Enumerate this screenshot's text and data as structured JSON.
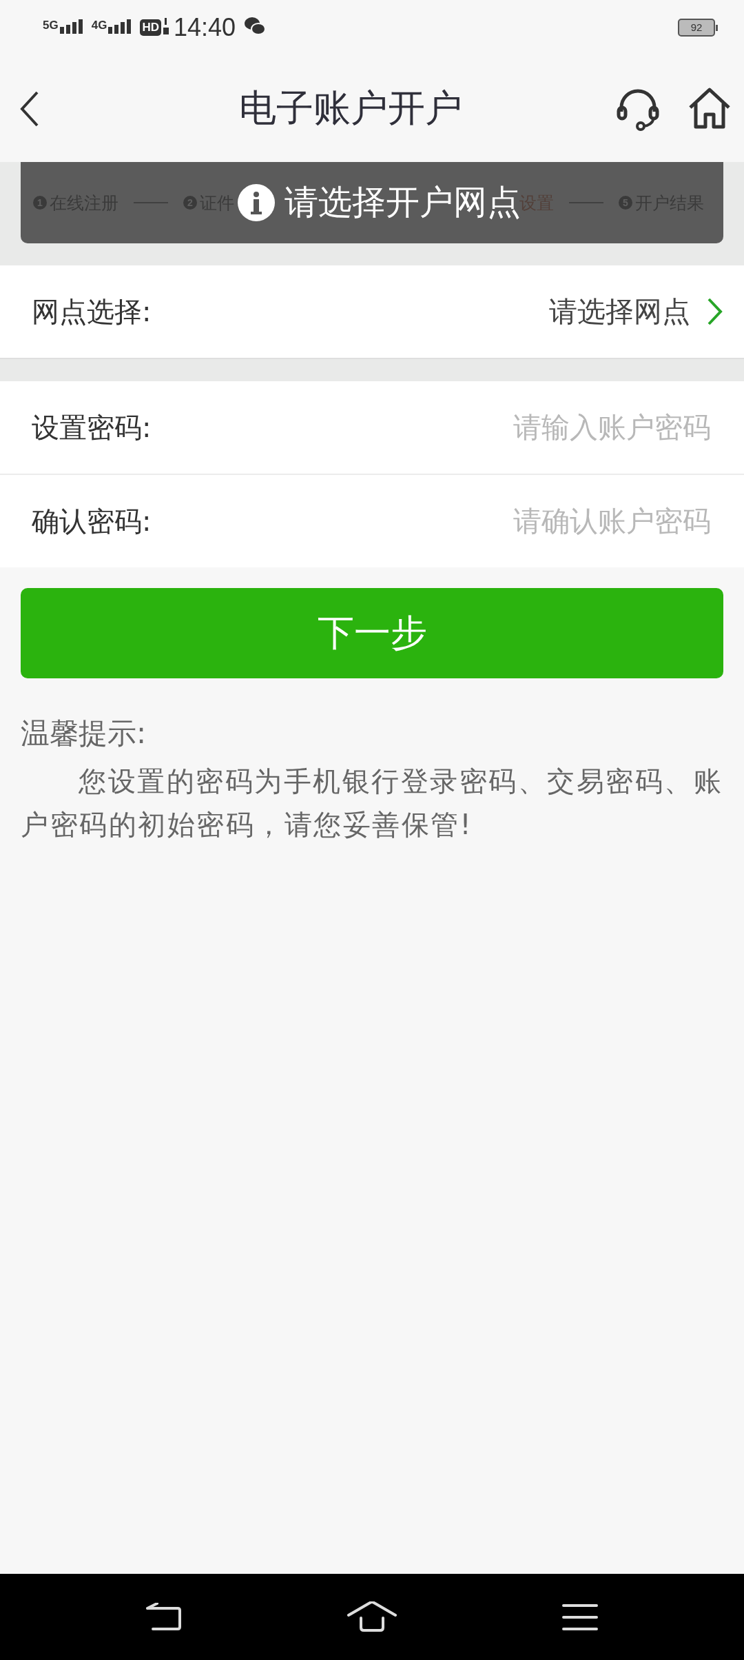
{
  "status_bar": {
    "networks": [
      {
        "label": "5G"
      },
      {
        "label": "4G"
      }
    ],
    "hd": "HD",
    "time": "14:40",
    "battery": "92"
  },
  "header": {
    "title": "电子账户开户"
  },
  "steps": [
    {
      "number": "1",
      "label": "在线注册",
      "active": false
    },
    {
      "number": "2",
      "label": "证件",
      "active": false
    },
    {
      "label": "设置",
      "active": true
    },
    {
      "number": "5",
      "label": "开户结果",
      "active": false
    }
  ],
  "toast": {
    "message": "请选择开户网点"
  },
  "branch": {
    "label": "网点选择:",
    "value": "请选择网点"
  },
  "password_fields": [
    {
      "label": "设置密码:",
      "placeholder": "请输入账户密码"
    },
    {
      "label": "确认密码:",
      "placeholder": "请确认账户密码"
    }
  ],
  "next_button": "下一步",
  "tips": {
    "title": "温馨提示:",
    "body": "您设置的密码为手机银行登录密码、交易密码、账户密码的初始密码，请您妥善保管!"
  }
}
